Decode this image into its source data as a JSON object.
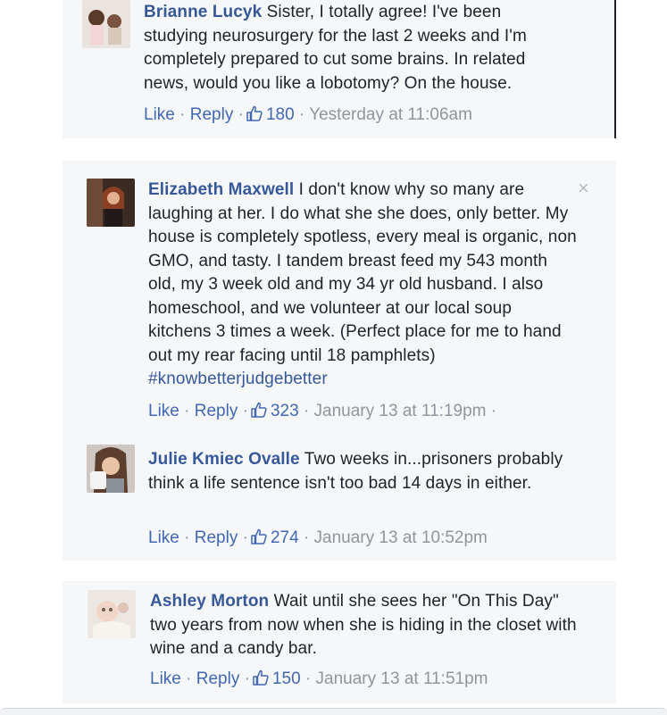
{
  "comments": [
    {
      "author": "Brianne Lucyk",
      "text": "Sister, I totally agree! I've been studying neurosurgery for the last 2 weeks and I'm completely prepared to cut some brains. In related news, would you like a lobotomy? On the house.",
      "like_label": "Like",
      "reply_label": "Reply",
      "likes": "180",
      "timestamp": "Yesterday at 11:06am"
    },
    {
      "author": "Elizabeth Maxwell",
      "text": "I don't know why so many are laughing at her. I do what she she does, only better. My house is completely spotless, every meal is organic, non GMO, and tasty. I tandem breast feed my 543 month old, my 3 week old and my 34 yr old husband. I also homeschool, and we volunteer at our local soup kitchens 3 times a week. (Perfect place for me to hand out my rear facing until 18 pamphlets)",
      "hashtag": "#knowbetterjudgebetter",
      "like_label": "Like",
      "reply_label": "Reply",
      "likes": "323",
      "timestamp": "January 13 at 11:19pm",
      "close_glyph": "×"
    },
    {
      "author": "Julie Kmiec Ovalle",
      "text": "Two weeks in...prisoners probably think a life sentence isn't too bad 14 days in either.",
      "like_label": "Like",
      "reply_label": "Reply",
      "likes": "274",
      "timestamp": "January 13 at 10:52pm"
    },
    {
      "author": "Ashley Morton",
      "text": "Wait until she sees her \"On This Day\" two years from now when she is hiding in the closet with wine and a candy bar.",
      "like_label": "Like",
      "reply_label": "Reply",
      "likes": "150",
      "timestamp": "January 13 at 11:51pm"
    }
  ],
  "separator": "·",
  "colors": {
    "author": "#365899",
    "link": "#4267b2",
    "meta": "#90949c",
    "card_bg": "#f6f7f9"
  },
  "icons": {
    "like": "thumbs-up-icon",
    "close": "close-icon"
  }
}
